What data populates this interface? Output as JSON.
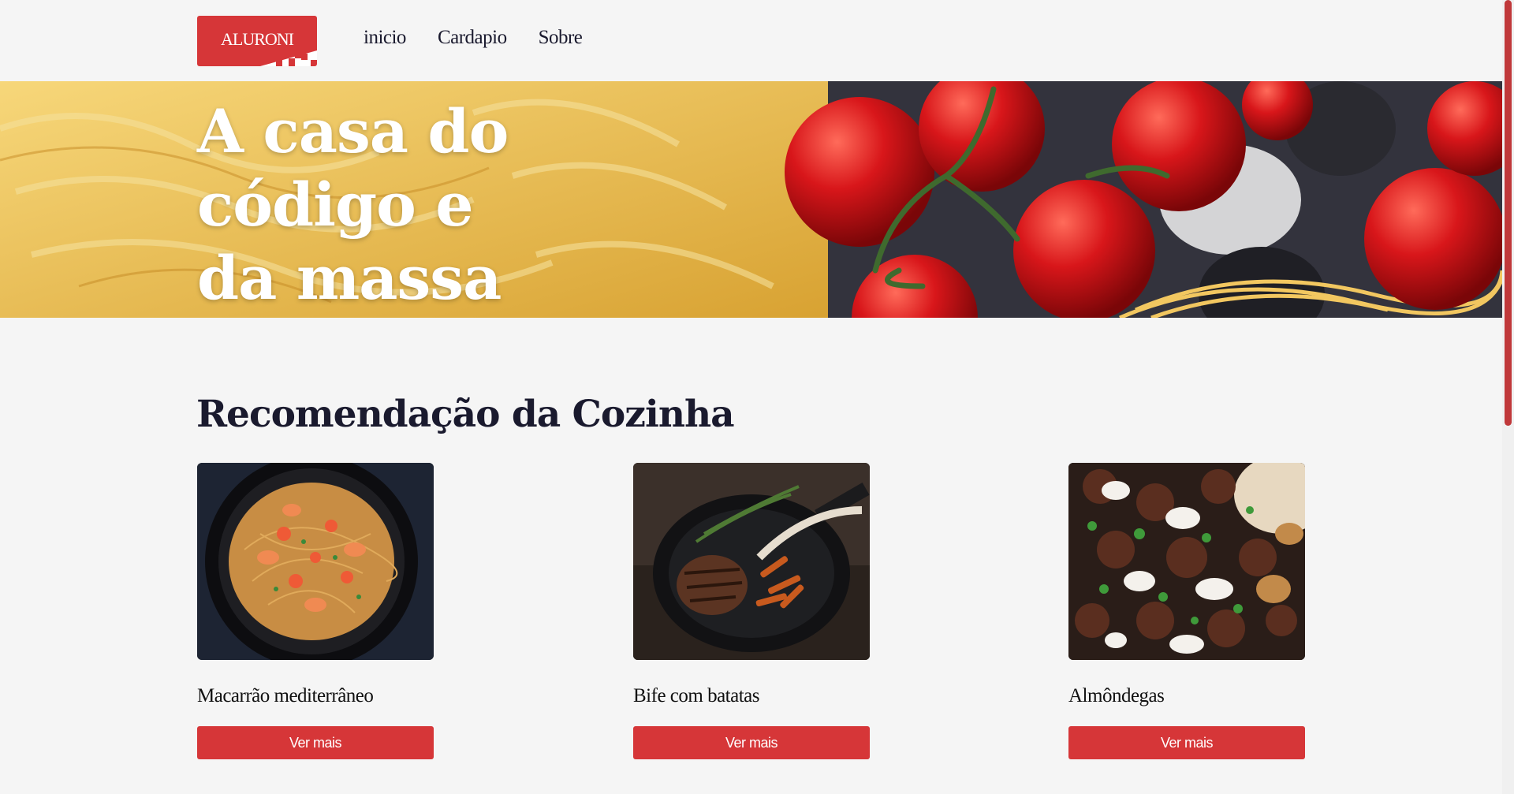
{
  "header": {
    "logo_text": "ALURONI",
    "nav": [
      {
        "label": "inicio"
      },
      {
        "label": "Cardapio"
      },
      {
        "label": "Sobre"
      }
    ]
  },
  "hero": {
    "title": "A casa do código e da massa"
  },
  "recommendations": {
    "title": "Recomendação da Cozinha",
    "items": [
      {
        "name": "Macarrão mediterrâneo",
        "button": "Ver mais"
      },
      {
        "name": "Bife com batatas",
        "button": "Ver mais"
      },
      {
        "name": "Almôndegas",
        "button": "Ver mais"
      }
    ]
  },
  "colors": {
    "accent": "#d63638",
    "background": "#f5f5f5",
    "text": "#1a1a2e"
  }
}
